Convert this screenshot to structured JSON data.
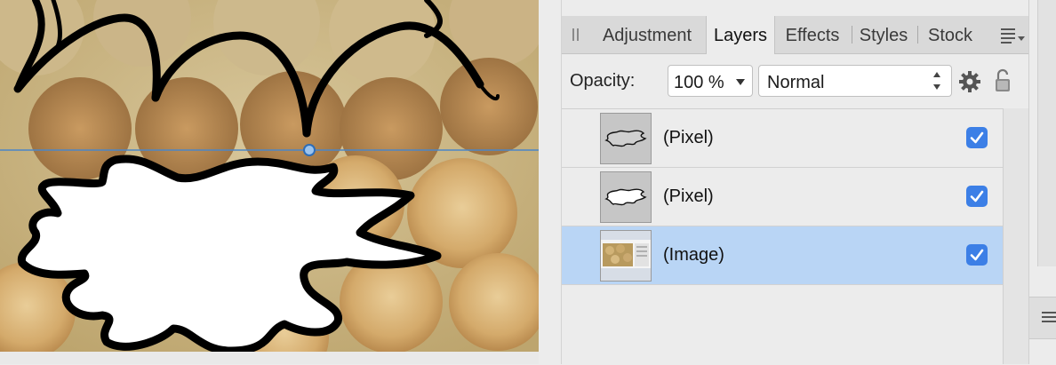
{
  "panel": {
    "tabs": [
      {
        "label": "Adjustment"
      },
      {
        "label": "Layers"
      },
      {
        "label": "Effects"
      },
      {
        "label": "Styles"
      },
      {
        "label": "Stock"
      }
    ],
    "active_tab": "Layers",
    "opacity_label": "Opacity:",
    "opacity_value": "100 %",
    "blend_mode": "Normal",
    "layers": [
      {
        "name": "(Pixel)",
        "visible": true,
        "selected": false
      },
      {
        "name": "(Pixel)",
        "visible": true,
        "selected": false
      },
      {
        "name": "(Image)",
        "visible": true,
        "selected": true
      }
    ]
  },
  "colors": {
    "accent": "#3c7fe6",
    "selection": "#b9d5f5",
    "guide_line": "#4a86c8"
  },
  "icons": [
    "panel-grip-icon",
    "panel-menu-icon",
    "settings-gear-icon",
    "lock-icon",
    "checkbox-checked-icon"
  ]
}
